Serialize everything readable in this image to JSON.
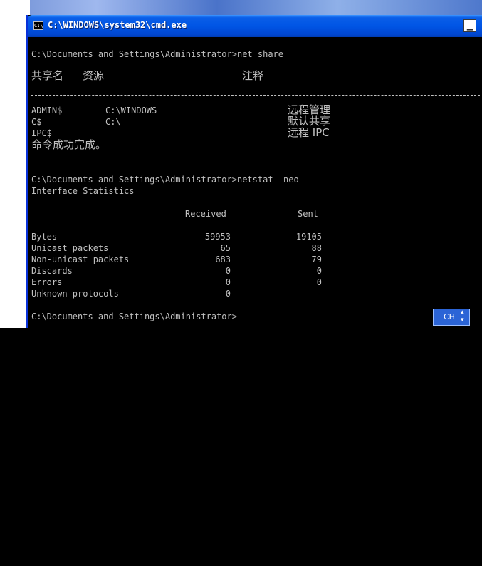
{
  "window": {
    "title": "C:\\WINDOWS\\system32\\cmd.exe",
    "icon_text": "C:\\",
    "minimize_symbol": "_",
    "colors": {
      "titlebar": "#0055e5",
      "console_bg": "#000000",
      "console_text": "#c0c0c0"
    }
  },
  "console": {
    "cmd1": "C:\\Documents and Settings\\Administrator>net share",
    "share_header": {
      "name": "共享名",
      "resource": "资源",
      "remark": "注释"
    },
    "separator": "-------------------------------------------------------------------------------",
    "shares": [
      {
        "name": "ADMIN$",
        "resource": "C:\\WINDOWS",
        "remark": "远程管理"
      },
      {
        "name": "C$",
        "resource": "C:\\",
        "remark": "默认共享"
      },
      {
        "name": "IPC$",
        "resource": "",
        "remark": "远程 IPC"
      }
    ],
    "share_done": "命令成功完成。",
    "cmd2": "C:\\Documents and Settings\\Administrator>netstat -neo",
    "stats_title": "Interface Statistics",
    "stats_header": {
      "received": "Received",
      "sent": "Sent"
    },
    "stats": [
      {
        "label": "Bytes",
        "received": "59953",
        "sent": "19105"
      },
      {
        "label": "Unicast packets",
        "received": "65",
        "sent": "88"
      },
      {
        "label": "Non-unicast packets",
        "received": "683",
        "sent": "79"
      },
      {
        "label": "Discards",
        "received": "0",
        "sent": "0"
      },
      {
        "label": "Errors",
        "received": "0",
        "sent": "0"
      },
      {
        "label": "Unknown protocols",
        "received": "0",
        "sent": ""
      }
    ],
    "prompt": "C:\\Documents and Settings\\Administrator>"
  },
  "ime": {
    "label": "CH",
    "icon": "scroll-arrows-icon"
  }
}
